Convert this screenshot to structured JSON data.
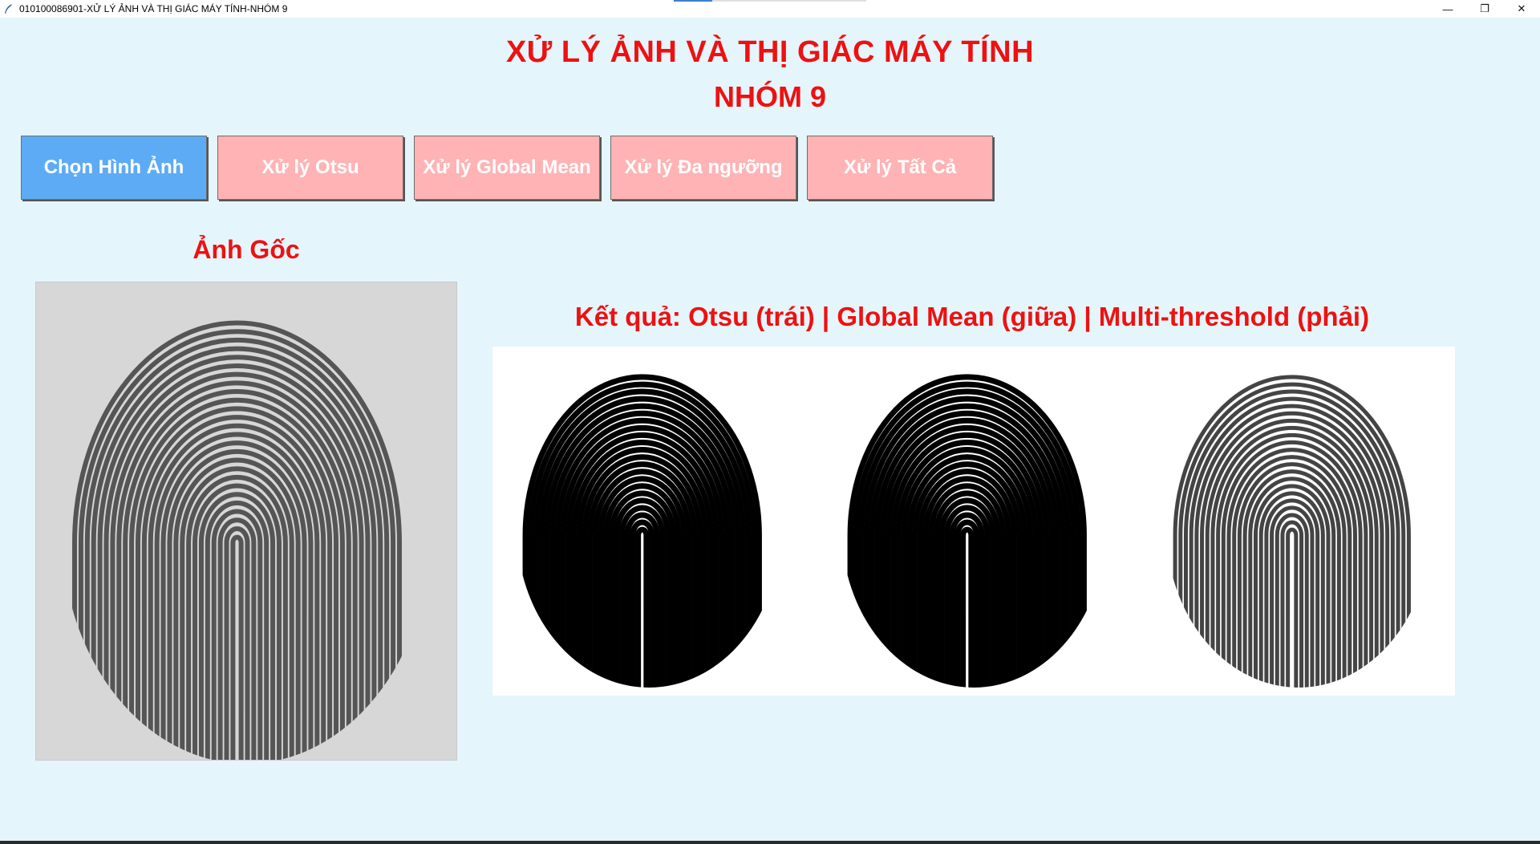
{
  "window": {
    "title": "010100086901-XỬ LÝ ẢNH VÀ THỊ GIÁC MÁY TÍNH-NHÓM 9",
    "controls": {
      "minimize": "—",
      "maximize": "❐",
      "close": "✕"
    }
  },
  "header": {
    "title": "XỬ LÝ ẢNH VÀ THỊ GIÁC MÁY TÍNH",
    "subtitle": "NHÓM 9"
  },
  "toolbar": {
    "buttons": [
      {
        "label": "Chọn Hình Ảnh",
        "color": "#5dabf5"
      },
      {
        "label": "Xử lý Otsu",
        "color": "#ffb3b5"
      },
      {
        "label": "Xử lý Global Mean",
        "color": "#ffb3b5"
      },
      {
        "label": "Xử lý Đa ngưỡng",
        "color": "#ffb3b5"
      },
      {
        "label": "Xử lý Tất Cả",
        "color": "#ffb3b5"
      }
    ]
  },
  "original": {
    "label": "Ảnh Gốc",
    "image": "fingerprint-grayscale"
  },
  "results": {
    "label": "Kết quả: Otsu (trái) | Global Mean (giữa) | Multi-threshold (phải)",
    "images": [
      "fingerprint-otsu",
      "fingerprint-global-mean",
      "fingerprint-multi-threshold"
    ]
  },
  "colors": {
    "background": "#e4f5fc",
    "heading": "#ee1111",
    "primary_button": "#5dabf5",
    "secondary_button": "#ffb3b5"
  }
}
